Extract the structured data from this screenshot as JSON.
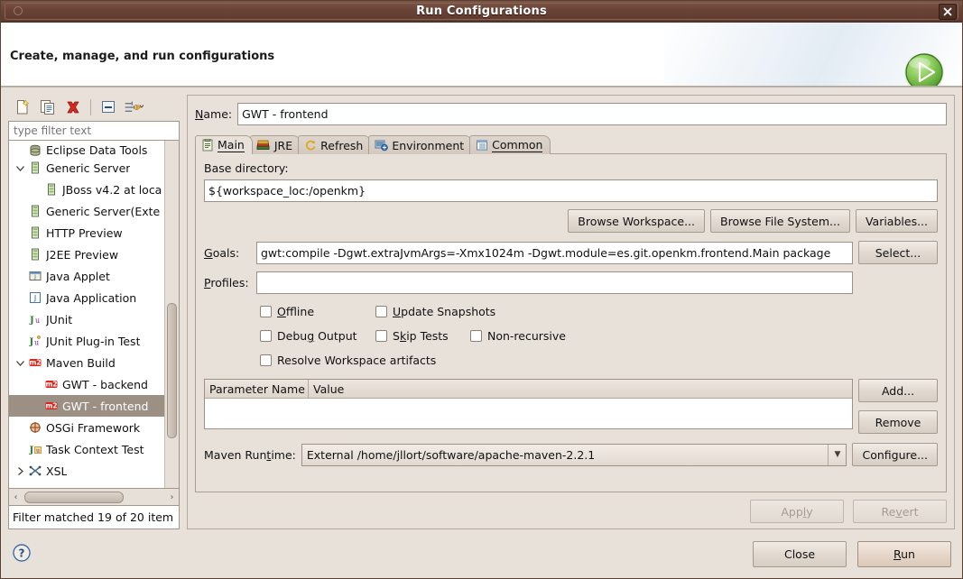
{
  "window": {
    "title": "Run Configurations",
    "close_label": "✕"
  },
  "header": {
    "title": "Create, manage, and run configurations",
    "badge_icon": "run-green-arrow-icon"
  },
  "sidebar": {
    "toolbar": [
      {
        "name": "new-configuration-icon",
        "tooltip": "New launch configuration"
      },
      {
        "name": "duplicate-configuration-icon",
        "tooltip": "Duplicate currently selected launch configuration"
      },
      {
        "name": "delete-configuration-icon",
        "tooltip": "Delete selected launch configuration(s)"
      },
      {
        "name": "collapse-all-icon",
        "tooltip": "Collapse All"
      },
      {
        "name": "filter-dropdown-icon",
        "tooltip": "Filter launch configurations"
      }
    ],
    "filter": {
      "value": "",
      "placeholder": "type filter text"
    },
    "tree": [
      {
        "label": "Eclipse Data Tools",
        "icon": "database-icon",
        "indent": 1,
        "twisty": "none",
        "selected": false,
        "clipped": true
      },
      {
        "label": "Generic Server",
        "icon": "server-icon",
        "indent": 0,
        "twisty": "expanded",
        "selected": false
      },
      {
        "label": "JBoss v4.2 at loca",
        "icon": "server-icon",
        "indent": 2,
        "twisty": "none",
        "selected": false
      },
      {
        "label": "Generic Server(Exte",
        "icon": "server-icon",
        "indent": 1,
        "twisty": "none",
        "selected": false
      },
      {
        "label": "HTTP Preview",
        "icon": "server-icon",
        "indent": 1,
        "twisty": "none",
        "selected": false
      },
      {
        "label": "J2EE Preview",
        "icon": "server-icon",
        "indent": 1,
        "twisty": "none",
        "selected": false
      },
      {
        "label": "Java Applet",
        "icon": "java-applet-icon",
        "indent": 1,
        "twisty": "none",
        "selected": false
      },
      {
        "label": "Java Application",
        "icon": "java-application-icon",
        "indent": 1,
        "twisty": "none",
        "selected": false
      },
      {
        "label": "JUnit",
        "icon": "junit-icon",
        "indent": 1,
        "twisty": "none",
        "selected": false
      },
      {
        "label": "JUnit Plug-in Test",
        "icon": "junit-plugin-icon",
        "indent": 1,
        "twisty": "none",
        "selected": false
      },
      {
        "label": "Maven Build",
        "icon": "maven-icon",
        "indent": 0,
        "twisty": "expanded",
        "selected": false
      },
      {
        "label": "GWT - backend",
        "icon": "maven-icon",
        "indent": 2,
        "twisty": "none",
        "selected": false
      },
      {
        "label": "GWT - frontend",
        "icon": "maven-icon",
        "indent": 2,
        "twisty": "none",
        "selected": true
      },
      {
        "label": "OSGi Framework",
        "icon": "osgi-icon",
        "indent": 1,
        "twisty": "none",
        "selected": false
      },
      {
        "label": "Task Context Test",
        "icon": "task-context-icon",
        "indent": 1,
        "twisty": "none",
        "selected": false
      },
      {
        "label": "XSL",
        "icon": "xsl-icon",
        "indent": 0,
        "twisty": "collapsed",
        "selected": false
      }
    ],
    "status": "Filter matched 19 of 20 item"
  },
  "main": {
    "name_label": "Name:",
    "name_value": "GWT - frontend",
    "tabs": [
      {
        "label": "Main",
        "icon": "main-tab-icon",
        "active": true
      },
      {
        "label": "JRE",
        "icon": "jre-tab-icon",
        "active": false
      },
      {
        "label": "Refresh",
        "icon": "refresh-tab-icon",
        "active": false
      },
      {
        "label": "Environment",
        "icon": "environment-tab-icon",
        "active": false
      },
      {
        "label": "Common",
        "icon": "common-tab-icon",
        "active": false
      }
    ],
    "base_directory_label": "Base directory:",
    "base_directory_value": "${workspace_loc:/openkm}",
    "browse_workspace_label": "Browse Workspace...",
    "browse_filesystem_label": "Browse File System...",
    "variables_label": "Variables...",
    "goals_label": "Goals:",
    "goals_value": "gwt:compile -Dgwt.extraJvmArgs=-Xmx1024m -Dgwt.module=es.git.openkm.frontend.Main package",
    "select_label": "Select...",
    "profiles_label": "Profiles:",
    "profiles_value": "",
    "checkboxes": [
      {
        "label": "Offline",
        "checked": false
      },
      {
        "label": "Update Snapshots",
        "checked": false
      },
      {
        "label": "Debug Output",
        "checked": false
      },
      {
        "label": "Skip Tests",
        "checked": false
      },
      {
        "label": "Non-recursive",
        "checked": false
      },
      {
        "label": "Resolve Workspace artifacts",
        "checked": false
      }
    ],
    "parameters": {
      "columns": [
        "Parameter Name",
        "Value"
      ],
      "rows": [],
      "add_label": "Add...",
      "remove_label": "Remove"
    },
    "maven_runtime_label": "Maven Runtime:",
    "maven_runtime_value": "External /home/jllort/software/apache-maven-2.2.1",
    "configure_label": "Configure...",
    "apply_label": "Apply",
    "revert_label": "Revert"
  },
  "footer": {
    "help_icon": "help-question-icon",
    "close_label": "Close",
    "run_label": "Run"
  },
  "colors": {
    "titlebar": "#6a4336",
    "dialog_background": "#e7e1da",
    "selection": "#9c8f84",
    "field_background": "#ffffff",
    "accent_green": "#6ab43c",
    "delete_red": "#cc2222"
  }
}
